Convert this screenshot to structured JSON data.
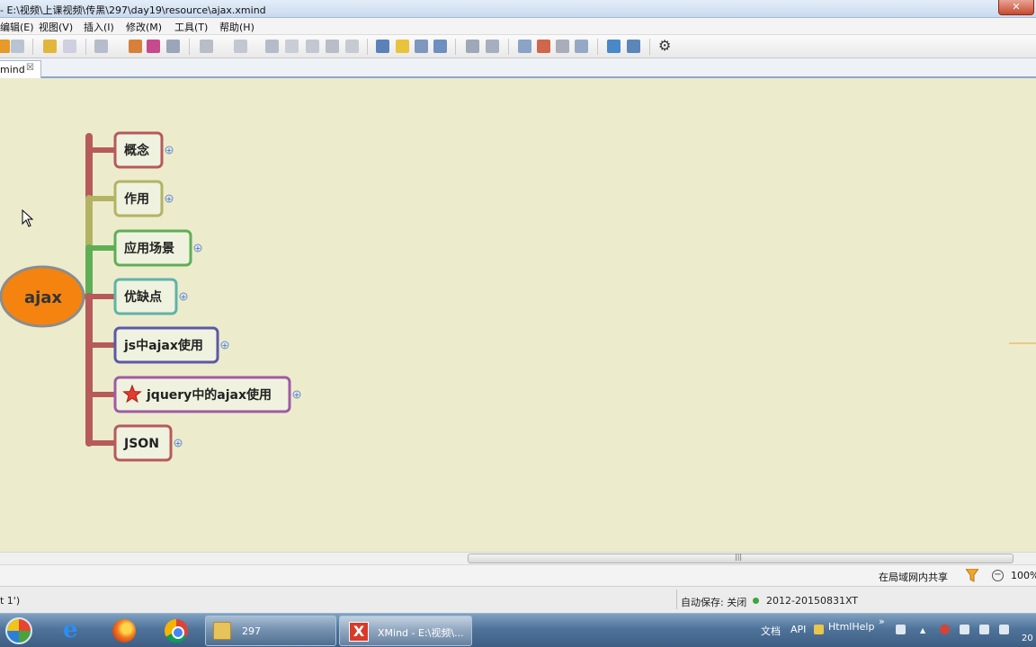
{
  "window": {
    "title": "- E:\\视频\\上课视频\\传黑\\297\\day19\\resource\\ajax.xmind",
    "close_glyph": "✕"
  },
  "menu": [
    {
      "label": "编辑(E)"
    },
    {
      "label": "视图(V)"
    },
    {
      "label": "插入(I)"
    },
    {
      "label": "修改(M)"
    },
    {
      "label": "工具(T)"
    },
    {
      "label": "帮助(H)"
    }
  ],
  "tab": {
    "label": "mind",
    "close": "☒"
  },
  "mindmap": {
    "central_topic": "ajax",
    "central_color": "#f4840f",
    "topics": [
      {
        "label": "概念",
        "border_color": "#b65a5a",
        "branch_color": "#b65a5a"
      },
      {
        "label": "作用",
        "border_color": "#b3b364",
        "branch_color": "#b3b364"
      },
      {
        "label": "应用场景",
        "border_color": "#5fae55",
        "branch_color": "#5fae55"
      },
      {
        "label": "优缺点",
        "border_color": "#5fb3a6",
        "branch_color": "#b65a5a"
      },
      {
        "label": "js中ajax使用",
        "border_color": "#5b58a8",
        "branch_color": "#b65a5a"
      },
      {
        "label": "jquery中的ajax使用",
        "border_color": "#a05aa5",
        "branch_color": "#b65a5a",
        "marker": "star-icon"
      },
      {
        "label": "JSON",
        "border_color": "#b65a5a",
        "branch_color": "#b65a5a"
      }
    ],
    "expand_glyph": "+"
  },
  "scrollbar": {
    "grip": "|||"
  },
  "statusbar": {
    "share": "在局域网内共享",
    "zoom_out": "−",
    "zoom": "100%"
  },
  "infobar": {
    "left": "t 1')",
    "autosave": "自动保存: 关闭",
    "version": "2012-20150831XT"
  },
  "taskbar": {
    "folder_label": "297",
    "xmind_label": "XMind - E:\\视频\\...",
    "xmind_icon": "X",
    "ie_glyph": "e",
    "tray_docs": "文档",
    "tray_api": "API",
    "tray_htmlhelp": "HtmlHelp",
    "tray_more": "»",
    "tray_up": "▲",
    "time": "20"
  }
}
